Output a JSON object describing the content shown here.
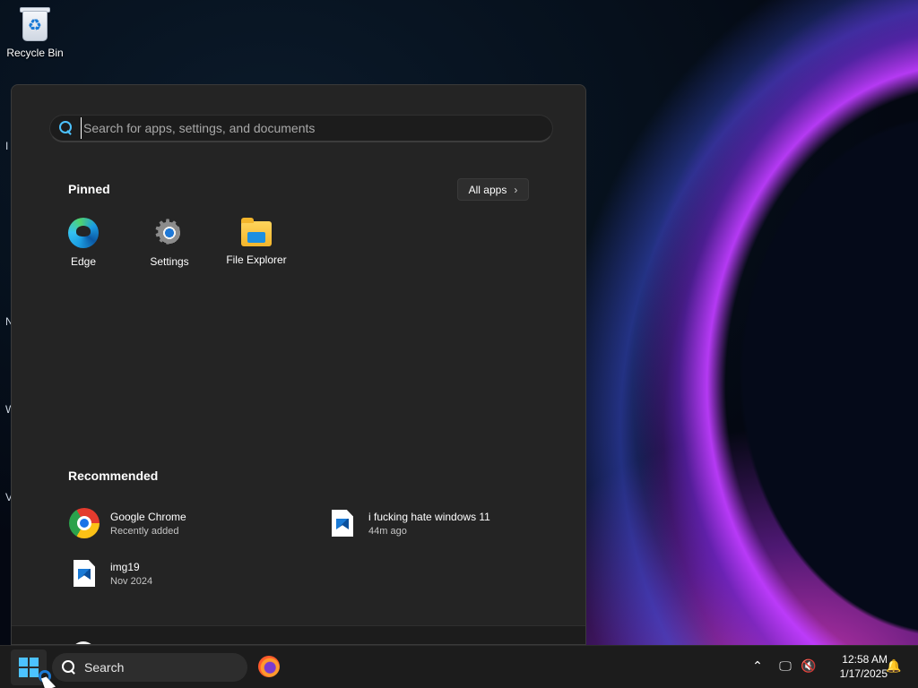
{
  "desktop": {
    "icons": [
      {
        "label": "Recycle Bin",
        "icon": "recycle-bin-icon"
      }
    ],
    "edge_letters": [
      "I",
      "N",
      "W",
      "V"
    ]
  },
  "start_menu": {
    "search": {
      "placeholder": "Search for apps, settings, and documents",
      "value": ""
    },
    "pinned": {
      "title": "Pinned",
      "all_apps_label": "All apps",
      "apps": [
        {
          "label": "Edge",
          "icon": "edge-icon"
        },
        {
          "label": "Settings",
          "icon": "gear-icon"
        },
        {
          "label": "File Explorer",
          "icon": "folder-icon"
        }
      ]
    },
    "recommended": {
      "title": "Recommended",
      "items": [
        {
          "name": "Google Chrome",
          "sub": "Recently added",
          "icon": "chrome-icon"
        },
        {
          "name": "i fucking hate windows 11",
          "sub": "44m ago",
          "icon": "image-file-icon"
        },
        {
          "name": "img19",
          "sub": "Nov 2024",
          "icon": "image-file-icon"
        }
      ]
    }
  },
  "taskbar": {
    "search_label": "Search",
    "clock": {
      "time": "12:58 AM",
      "date": "1/17/2025"
    },
    "accent": "#4cc2ff"
  }
}
